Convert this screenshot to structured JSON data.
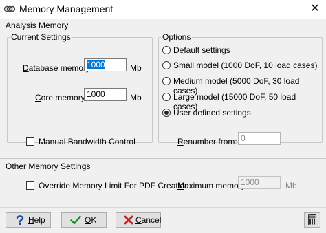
{
  "window": {
    "title": "Memory Management",
    "close_glyph": "✕"
  },
  "analysis_memory": {
    "label": "Analysis Memory",
    "current_settings": {
      "label": "Current Settings",
      "database_memory": {
        "label_u": "D",
        "label_rest": "atabase memory:",
        "value": "1000",
        "unit": "Mb"
      },
      "core_memory": {
        "label_u": "C",
        "label_rest": "ore memory:",
        "value": "1000",
        "unit": "Mb"
      }
    },
    "options": {
      "label": "Options",
      "items": [
        {
          "label": "Default settings",
          "selected": false
        },
        {
          "label": "Small model (1000 DoF, 10 load cases)",
          "selected": false
        },
        {
          "label": "Medium model (5000 DoF, 30 load cases)",
          "selected": false
        },
        {
          "label": "Large model (15000 DoF, 50 load cases)",
          "selected": false
        },
        {
          "label": "User defined settings",
          "selected": true
        }
      ]
    },
    "manual_bandwidth": {
      "label": "Manual Bandwidth Control",
      "checked": false
    },
    "renumber_from": {
      "label_u": "R",
      "label_rest": "enumber from:",
      "value": "0"
    }
  },
  "other_memory": {
    "label": "Other Memory Settings",
    "override_pdf": {
      "label": "Override Memory Limit For PDF Creation",
      "checked": false
    },
    "maximum_memory": {
      "label_u": "M",
      "label_rest": "aximum memory:",
      "value": "1000",
      "unit": "Mb"
    }
  },
  "footer": {
    "help": {
      "label_u": "H",
      "label_rest": "elp",
      "icon": "question-mark-icon"
    },
    "ok": {
      "label_u": "O",
      "label_rest": "K",
      "icon": "checkmark-icon"
    },
    "cancel": {
      "label_u": "C",
      "label_rest": "ancel",
      "icon": "x-mark-icon"
    },
    "calculator": {
      "icon": "calculator-icon"
    }
  },
  "colors": {
    "accent": "#0078d7",
    "ok_green": "#1f8f2a",
    "cancel_red": "#c81e1e",
    "help_blue": "#1b4fa8"
  }
}
